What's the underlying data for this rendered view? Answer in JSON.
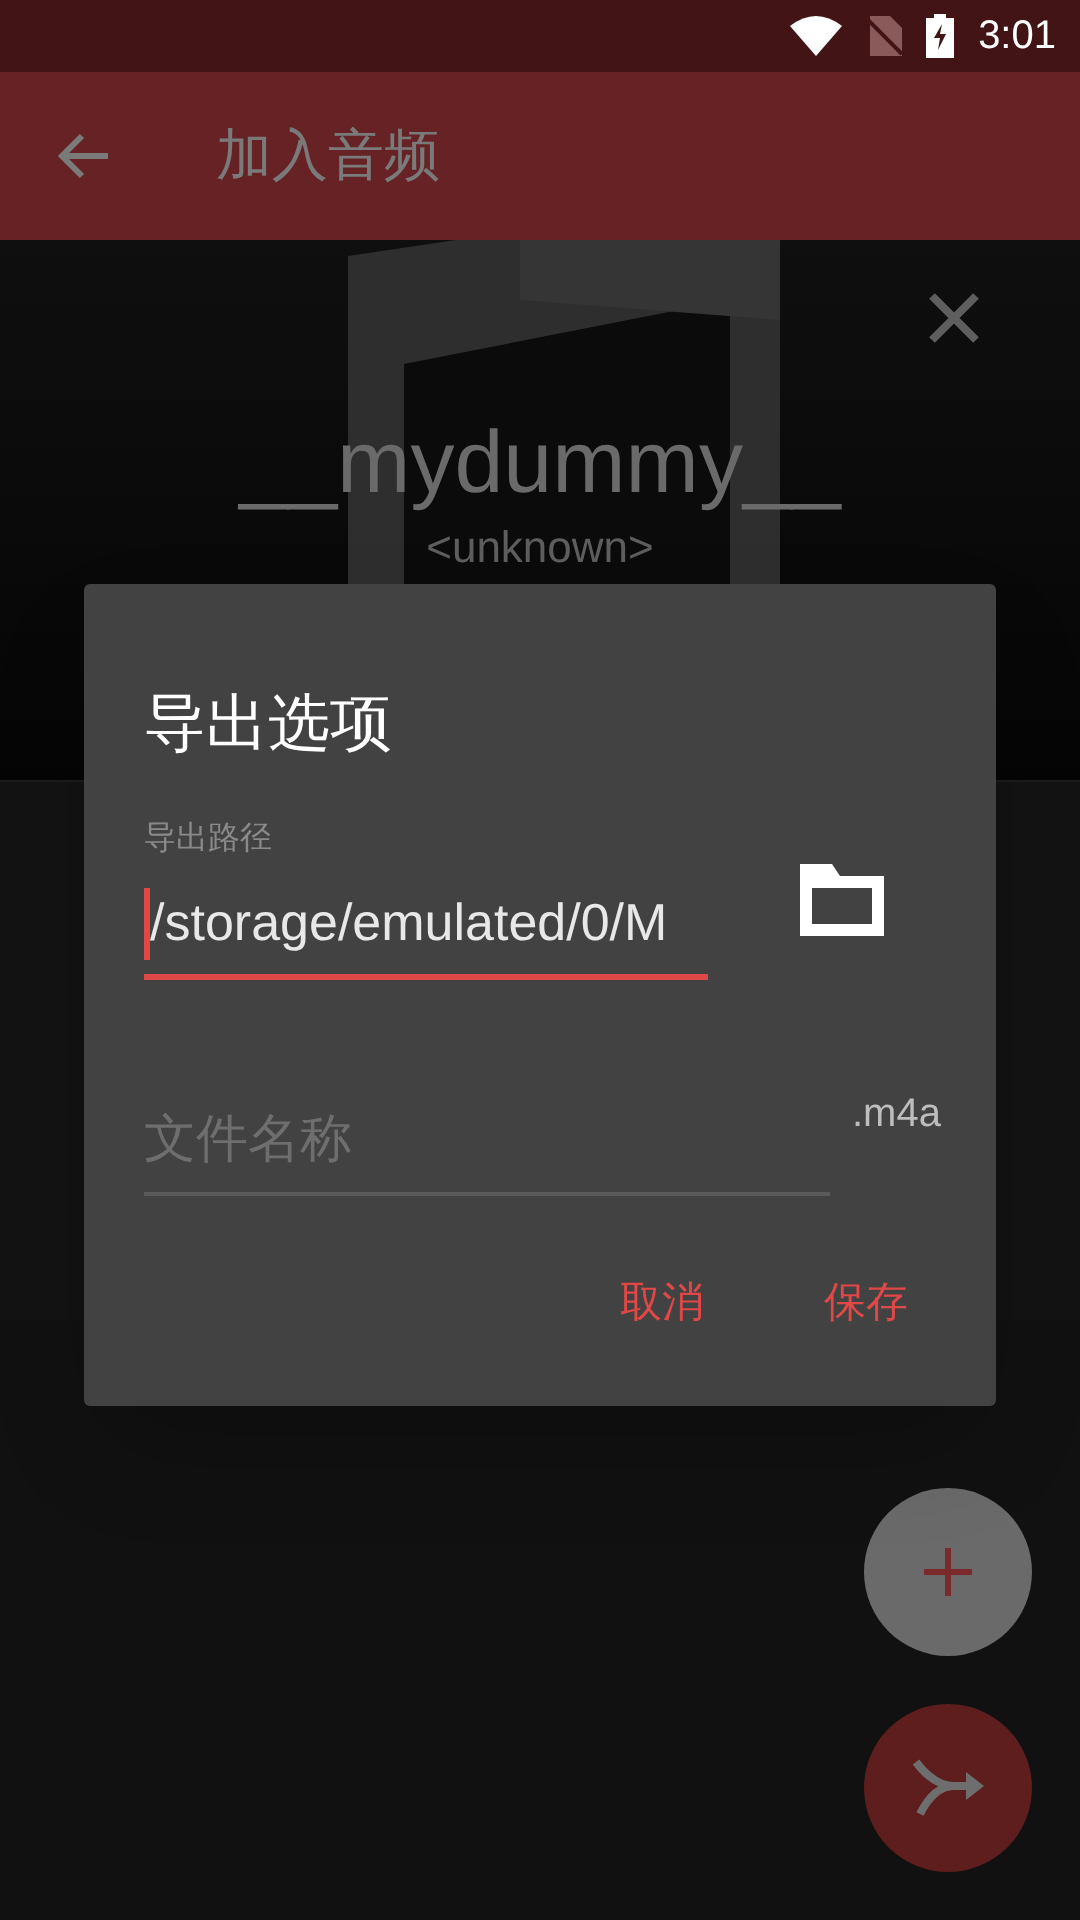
{
  "status_bar": {
    "time": "3:01"
  },
  "app_bar": {
    "title": "加入音频"
  },
  "track": {
    "title": "__mydummy__",
    "artist": "<unknown>"
  },
  "dialog": {
    "title": "导出选项",
    "path_field": {
      "label": "导出路径",
      "value": "/storage/emulated/0/M",
      "focused": true
    },
    "name_field": {
      "placeholder": "文件名称",
      "suffix": ".m4a",
      "focused": false
    },
    "buttons": [
      "取消",
      "保存"
    ]
  }
}
